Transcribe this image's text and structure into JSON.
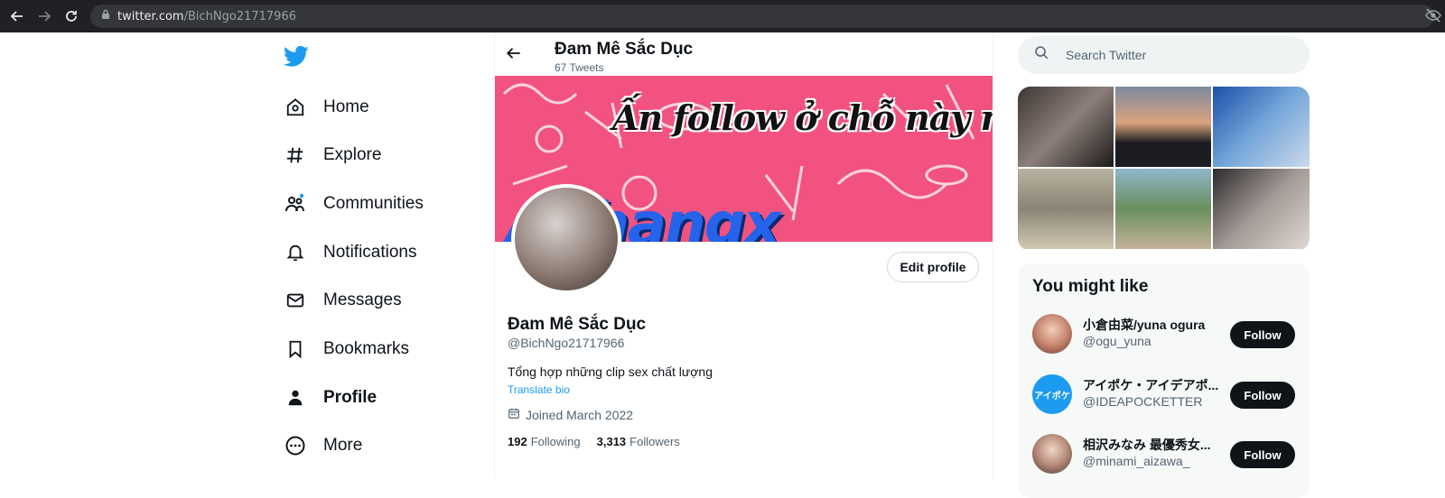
{
  "browser": {
    "url_domain": "twitter.com",
    "url_path": "/BichNgo21717966"
  },
  "sidebar": {
    "items": [
      {
        "label": "Home",
        "icon": "home-icon"
      },
      {
        "label": "Explore",
        "icon": "hashtag-icon"
      },
      {
        "label": "Communities",
        "icon": "communities-icon"
      },
      {
        "label": "Notifications",
        "icon": "bell-icon"
      },
      {
        "label": "Messages",
        "icon": "envelope-icon"
      },
      {
        "label": "Bookmarks",
        "icon": "bookmark-icon"
      },
      {
        "label": "Profile",
        "icon": "person-icon"
      },
      {
        "label": "More",
        "icon": "more-circle-icon"
      }
    ]
  },
  "header": {
    "title": "Đam Mê Sắc Dục",
    "tweet_count": "67 Tweets"
  },
  "banner": {
    "caption": "Ấn follow ở chỗ này này",
    "watermark": "Aphangx"
  },
  "profile": {
    "edit_label": "Edit profile",
    "name": "Đam Mê Sắc Dục",
    "handle": "@BichNgo21717966",
    "bio": "Tổng hợp những clip sex chất lượng",
    "translate_label": "Translate bio",
    "joined": "Joined March 2022",
    "following_count": "192",
    "following_label": "Following",
    "followers_count": "3,313",
    "followers_label": "Followers"
  },
  "search": {
    "placeholder": "Search Twitter"
  },
  "might_like": {
    "title": "You might like",
    "follow_label": "Follow",
    "items": [
      {
        "name": "小倉由菜/yuna ogura",
        "handle": "@ogu_yuna"
      },
      {
        "name": "アイポケ・アイデアポ...",
        "handle": "@IDEAPOCKETTER",
        "avatar_text": "アイポケ"
      },
      {
        "name": "相沢みなみ 最優秀女...",
        "handle": "@minami_aizawa_"
      }
    ]
  },
  "colors": {
    "accent": "#1d9bf0",
    "banner": "#f2527f",
    "text_primary": "#0f1419",
    "text_secondary": "#536471"
  }
}
